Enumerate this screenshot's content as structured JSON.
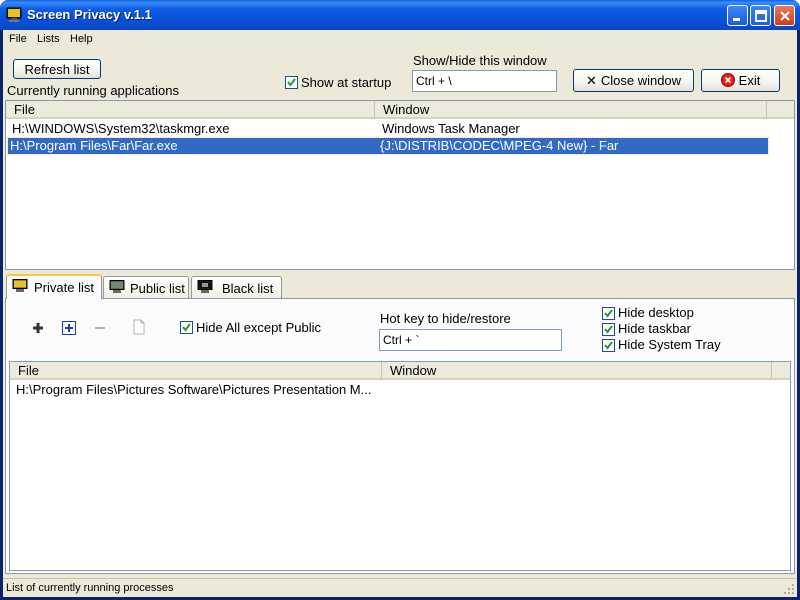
{
  "window": {
    "title": "Screen Privacy v.1.1",
    "accent": "#0a5fe8"
  },
  "menu": [
    "File",
    "Lists",
    "Help"
  ],
  "toolbar": {
    "refresh_label": "Refresh list",
    "running_label": "Currently running applications",
    "show_startup_label": "Show at startup",
    "show_startup_checked": true,
    "showhide_label": "Show/Hide this window",
    "showhide_value": "Ctrl + \\",
    "close_window_label": "Close window",
    "exit_label": "Exit"
  },
  "running_list": {
    "columns": [
      "File",
      "Window"
    ],
    "rows": [
      {
        "file": "H:\\WINDOWS\\System32\\taskmgr.exe",
        "window": "Windows Task Manager",
        "selected": false
      },
      {
        "file": "H:\\Program Files\\Far\\Far.exe",
        "window": "{J:\\DISTRIB\\CODEC\\MPEG-4 New} - Far",
        "selected": true
      }
    ]
  },
  "tabs": [
    {
      "label": "Private list",
      "icon": "monitor-icon",
      "active": true
    },
    {
      "label": "Public list",
      "icon": "monitor-icon",
      "active": false
    },
    {
      "label": "Black list",
      "icon": "black-monitor-icon",
      "active": false
    }
  ],
  "private": {
    "hide_all_label": "Hide All except Public",
    "hide_all_checked": true,
    "hotkey_label": "Hot key to hide/restore",
    "hotkey_value": "Ctrl + `",
    "hide_desktop_label": "Hide desktop",
    "hide_taskbar_label": "Hide taskbar",
    "hide_tray_label": "Hide System Tray",
    "columns": [
      "File",
      "Window"
    ],
    "rows": [
      {
        "file": "H:\\Program Files\\Pictures Software\\Pictures Presentation M...",
        "window": ""
      }
    ]
  },
  "status": {
    "text": "List of currently running processes"
  }
}
